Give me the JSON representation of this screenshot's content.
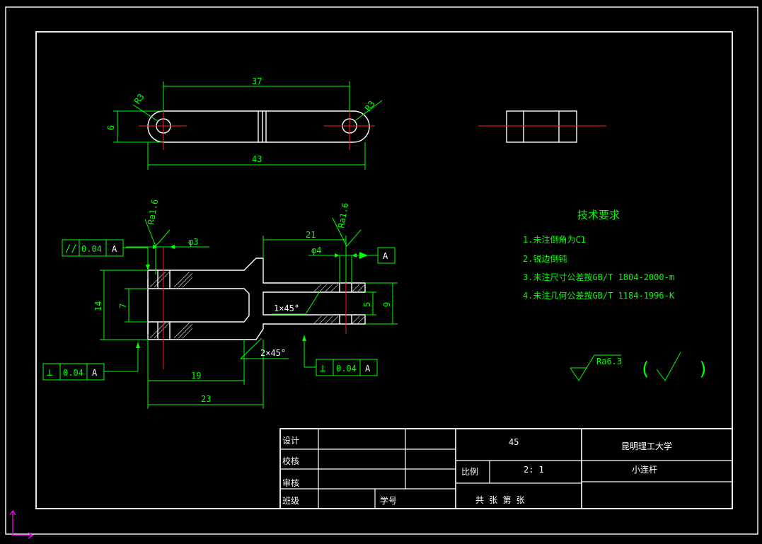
{
  "top_view": {
    "dim_length_top": "37",
    "dim_length_total": "43",
    "dim_height": "6",
    "radius_left": "R3",
    "radius_right": "R3"
  },
  "section_view": {
    "roughness_left": "Ra1.6",
    "roughness_right": "Ra1.6",
    "dia_left": "φ3",
    "dia_right": "φ4",
    "dim_21": "21",
    "dim_14": "14",
    "dim_7": "7",
    "dim_5": "5",
    "dim_9": "9",
    "dim_19": "19",
    "dim_23": "23",
    "chamfer_1": "1×45°",
    "chamfer_2": "2×45°",
    "datum": "A",
    "tol_parallel": {
      "symbol": "//",
      "value": "0.04",
      "datum": "A"
    },
    "tol_perp_left": {
      "symbol": "⊥",
      "value": "0.04",
      "datum": "A"
    },
    "tol_perp_right": {
      "symbol": "⊥",
      "value": "0.04",
      "datum": "A"
    }
  },
  "tech_requirements": {
    "title": "技术要求",
    "items": [
      "1.未注倒角为C1",
      "2.锐边倒钝",
      "3.未注尺寸公差按GB/T 1804-2000-m",
      "4.未注几何公差按GB/T 1184-1996-K"
    ],
    "general_roughness": "Ra6.3",
    "paren_open": "(",
    "paren_close": ")"
  },
  "title_block": {
    "design": "设计",
    "check": "校核",
    "review": "审核",
    "class": "班级",
    "student_no": "学号",
    "material": "45",
    "university": "昆明理工大学",
    "scale_label": "比例",
    "scale_value": "2: 1",
    "part_name": "小连杆",
    "sheets": "共  张  第  张"
  },
  "colors": {
    "background": "#000000",
    "outline": "#ffffff",
    "dimension": "#00ff00",
    "centerline": "#ff2020",
    "ucs": "#ff00ff"
  }
}
